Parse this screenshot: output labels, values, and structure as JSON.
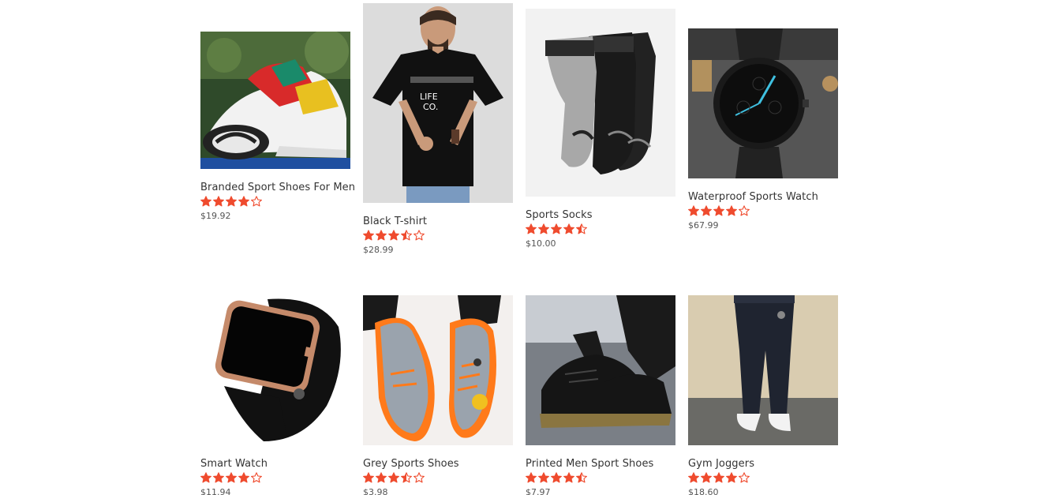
{
  "accent_color": "#ef4b2e",
  "products": [
    {
      "title": "Branded Sport Shoes For Men",
      "rating": 4,
      "price": "$19.92",
      "image_icon": "sneaker-product-image"
    },
    {
      "title": "Black T-shirt",
      "rating": 3.5,
      "price": "$28.99",
      "image_icon": "tshirt-product-image"
    },
    {
      "title": "Sports Socks",
      "rating": 4.5,
      "price": "$10.00",
      "image_icon": "socks-product-image"
    },
    {
      "title": "Waterproof Sports Watch",
      "rating": 4,
      "price": "$67.99",
      "image_icon": "watch-product-image"
    },
    {
      "title": "Smart Watch",
      "rating": 4,
      "price": "$11.94",
      "image_icon": "smartwatch-product-image"
    },
    {
      "title": "Grey Sports Shoes",
      "rating": 3.5,
      "price": "$3.98",
      "image_icon": "grey-shoes-product-image"
    },
    {
      "title": "Printed Men Sport Shoes",
      "rating": 4.5,
      "price": "$7.97",
      "image_icon": "black-shoes-product-image"
    },
    {
      "title": "Gym Joggers",
      "rating": 4,
      "price": "$18.60",
      "image_icon": "joggers-product-image"
    }
  ]
}
